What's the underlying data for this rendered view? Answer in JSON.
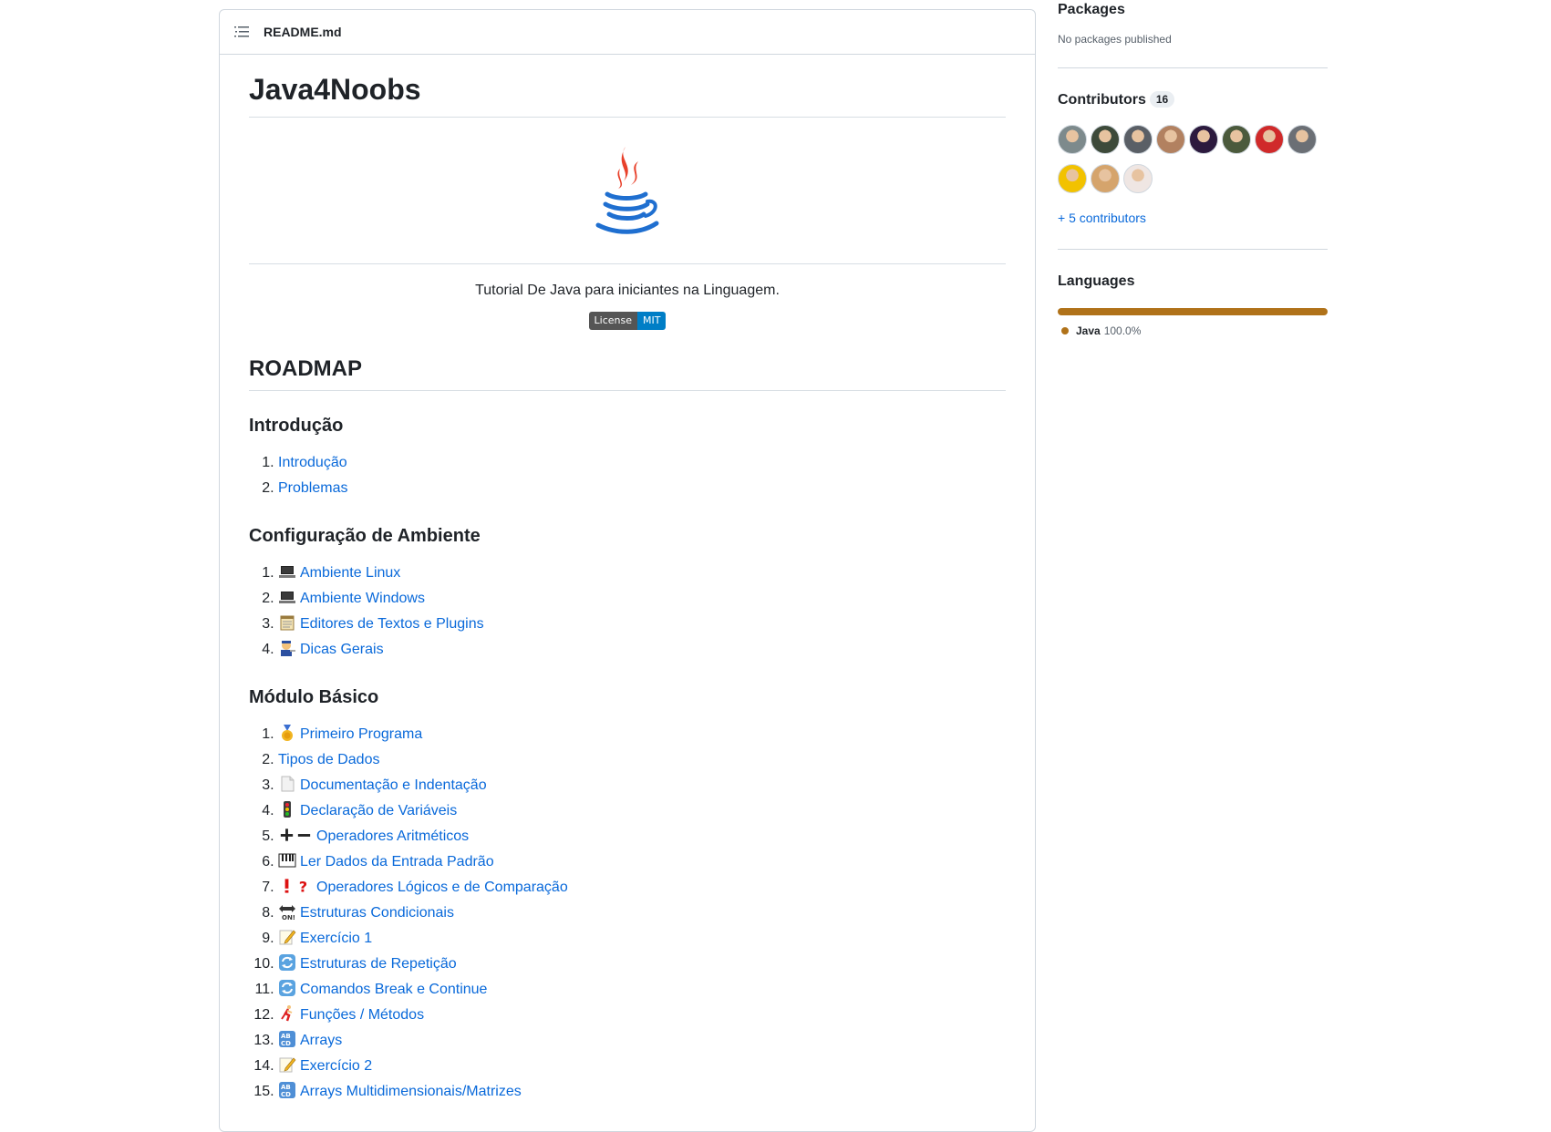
{
  "readme": {
    "filename": "README.md",
    "title": "Java4Noobs",
    "tagline": "Tutorial De Java para iniciantes na Linguagem.",
    "badge": {
      "key": "License",
      "value": "MIT"
    },
    "roadmap_heading": "ROADMAP",
    "sections": [
      {
        "heading": "Introdução",
        "items": [
          {
            "icon": "",
            "label": "Introdução"
          },
          {
            "icon": "",
            "label": "Problemas"
          }
        ]
      },
      {
        "heading": "Configuração de Ambiente",
        "items": [
          {
            "icon": "laptop-icon",
            "label": "Ambiente Linux"
          },
          {
            "icon": "laptop-icon",
            "label": "Ambiente Windows"
          },
          {
            "icon": "notepad-icon",
            "label": "Editores de Textos e Plugins"
          },
          {
            "icon": "mechanic-icon",
            "label": "Dicas Gerais"
          }
        ]
      },
      {
        "heading": "Módulo Básico",
        "items": [
          {
            "icon": "medal-icon",
            "label": "Primeiro Programa"
          },
          {
            "icon": "",
            "label": "Tipos de Dados"
          },
          {
            "icon": "page-icon",
            "label": "Documentação e Indentação"
          },
          {
            "icon": "traffic-light-icon",
            "label": "Declaração de Variáveis"
          },
          {
            "icon": "plus-minus-icon",
            "label": "Operadores Aritméticos"
          },
          {
            "icon": "piano-icon",
            "label": "Ler Dados da Entrada Padrão"
          },
          {
            "icon": "exclaim-question-icon",
            "label": "Operadores Lógicos e de Comparação"
          },
          {
            "icon": "on-arrow-icon",
            "label": "Estruturas Condicionais"
          },
          {
            "icon": "memo-icon",
            "label": "Exercício 1"
          },
          {
            "icon": "repeat-icon",
            "label": "Estruturas de Repetição"
          },
          {
            "icon": "repeat-icon",
            "label": "Comandos Break e Continue"
          },
          {
            "icon": "runner-icon",
            "label": "Funções / Métodos"
          },
          {
            "icon": "abcd-icon",
            "label": "Arrays"
          },
          {
            "icon": "memo-icon",
            "label": "Exercício 2"
          },
          {
            "icon": "abcd-icon",
            "label": "Arrays Multidimensionais/Matrizes"
          }
        ]
      }
    ]
  },
  "sidebar": {
    "packages": {
      "title": "Packages",
      "empty": "No packages published"
    },
    "contributors": {
      "title": "Contributors",
      "count": "16",
      "more": "+ 5 contributors",
      "avatar_colors": [
        "#7d8a8c",
        "#3d4a3a",
        "#5a5f66",
        "#b28160",
        "#2c1a3e",
        "#4b5a3c",
        "#d02a2a",
        "#6b6f75",
        "#f2c200",
        "#d5a46c",
        "#efe6e3"
      ]
    },
    "languages": {
      "title": "Languages",
      "items": [
        {
          "name": "Java",
          "percent": "100.0%",
          "color": "#b07219"
        }
      ]
    }
  }
}
